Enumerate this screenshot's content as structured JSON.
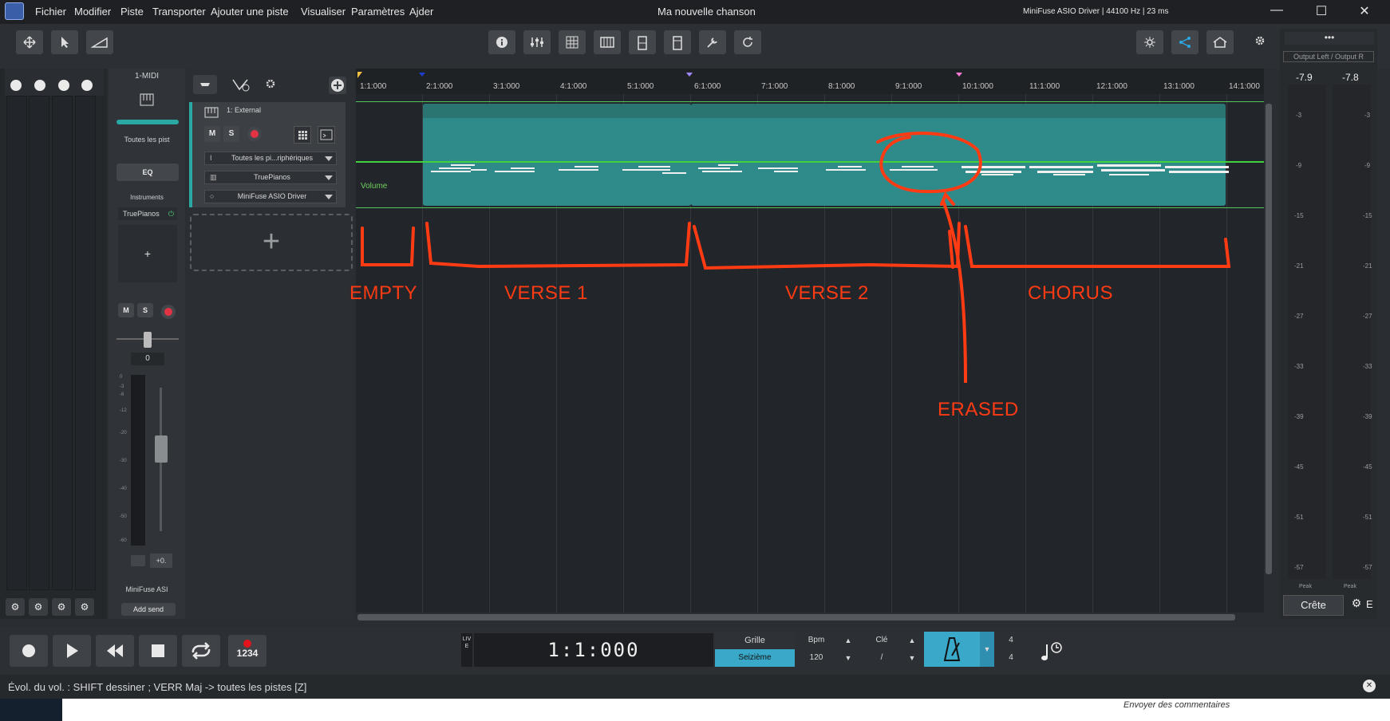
{
  "menubar": {
    "items": [
      "Fichier",
      "Modifier",
      "Piste",
      "Transporter",
      "Ajouter une piste",
      "Visualiser",
      "Paramètres",
      "Ajder"
    ],
    "title": "Ma nouvelle chanson",
    "driver": "MiniFuse ASIO Driver | 44100 Hz | 23 ms",
    "min": "—",
    "max": "☐",
    "close": "✕"
  },
  "mixer": {
    "channel_name": "1-MIDI",
    "all_tracks": "Toutes les pist",
    "eq": "EQ",
    "instruments_label": "Instruments",
    "instrument": "TruePianos",
    "add": "+",
    "mute": "M",
    "solo": "S",
    "volume_value": "0",
    "pan_value": "+0.",
    "output": "MiniFuse ASI",
    "add_send": "Add send",
    "fader_scale": [
      "0",
      "-3",
      "-6",
      "-12",
      "-20",
      "-30",
      "-40",
      "-50",
      "-60"
    ]
  },
  "track": {
    "name": "1: External",
    "mute": "M",
    "solo": "S",
    "input": "Toutes les pi...riphériques",
    "instrument": "TruePianos",
    "output": "MiniFuse ASIO Driver",
    "add_track": "+"
  },
  "arrange": {
    "bars": [
      "1:1:000",
      "2:1:000",
      "3:1:000",
      "4:1:000",
      "5:1:000",
      "6:1:000",
      "7:1:000",
      "8:1:000",
      "9:1:000",
      "10:1:000",
      "11:1:000",
      "12:1:000",
      "13:1:000",
      "14:1:000"
    ],
    "volume_label": "Volume"
  },
  "annotations": {
    "empty": "EMPTY",
    "verse1": "VERSE 1",
    "verse2": "VERSE 2",
    "chorus": "CHORUS",
    "erased": "ERASED"
  },
  "meter": {
    "header": "Output Left / Output R",
    "left_value": "-7.9",
    "right_value": "-7.8",
    "scale": [
      "-3",
      "-9",
      "-15",
      "-21",
      "-27",
      "-33",
      "-39",
      "-45",
      "-51",
      "-57"
    ],
    "peak_left": "Peak",
    "peak_right": "Peak",
    "crete": "Crête",
    "e": "E"
  },
  "transport": {
    "live": "LIVE",
    "position": "1:1:000",
    "grille_label": "Grille",
    "grille_value": "Seizième",
    "bpm_label": "Bpm",
    "bpm_value": "120",
    "cle_label": "Clé",
    "cle_value": "/",
    "sig_top": "4",
    "sig_bottom": "4",
    "count_in": "1234"
  },
  "status": {
    "text": "Évol. du vol. : SHIFT dessiner ; VERR Maj -> toutes les pistes [Z]",
    "feedback": "Envoyer des commentaires"
  },
  "colors": {
    "clip": "#2e8b8a",
    "clip_top": "#2a7472",
    "annotation": "#ff3b14",
    "accent": "#2aa8c4"
  }
}
